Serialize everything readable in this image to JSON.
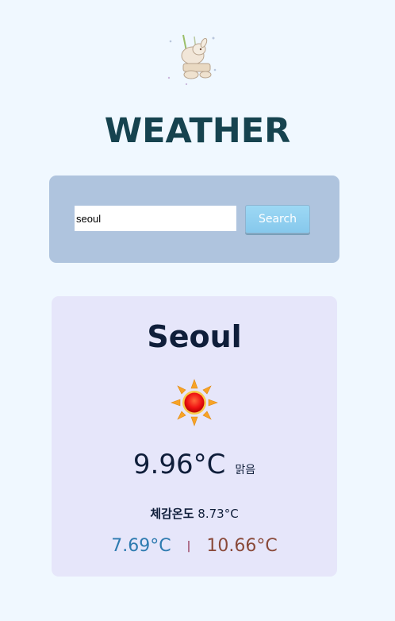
{
  "app": {
    "title": "WEATHER",
    "logo_icon": "swinging-rabbit-illustration"
  },
  "search": {
    "input_value": "seoul",
    "button_label": "Search"
  },
  "weather": {
    "city": "Seoul",
    "icon": "sun-icon",
    "temperature": "9.96°C",
    "condition": "맑음",
    "feels_like_label": "체감온도",
    "feels_like_value": "8.73°C",
    "temp_min": "7.69°C",
    "divider": "|",
    "temp_max": "10.66°C"
  },
  "colors": {
    "background": "#f0f8ff",
    "title": "#16434f",
    "search_panel": "#afc4de",
    "card": "#e6e6fa",
    "min_temp": "#2e7bb0",
    "max_temp": "#8a4a3a",
    "button": "#8fd0f0"
  }
}
